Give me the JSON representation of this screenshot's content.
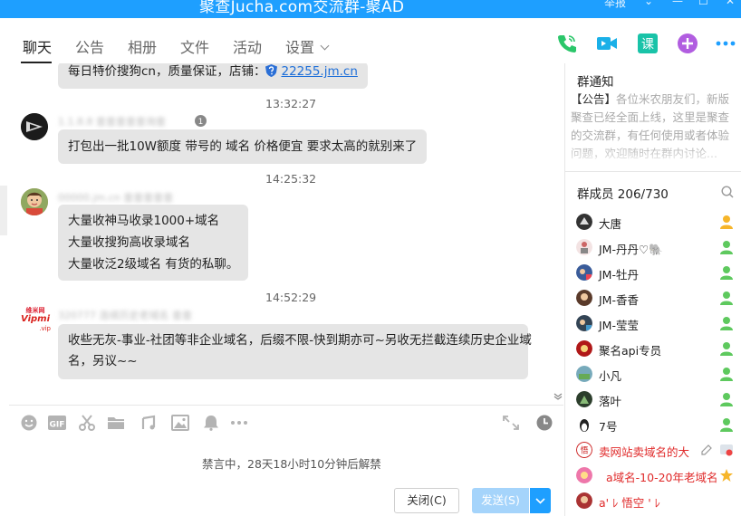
{
  "window": {
    "title": "聚查Jucha.com交流群-聚AD",
    "controls": [
      "举报",
      "⌄",
      "—",
      "☐",
      "✕"
    ]
  },
  "tabs": [
    {
      "label": "聊天"
    },
    {
      "label": "公告"
    },
    {
      "label": "相册"
    },
    {
      "label": "文件"
    },
    {
      "label": "活动"
    },
    {
      "label": "设置"
    }
  ],
  "messages": {
    "m0": {
      "text": "每日特价搜狗cn，质量保证，店铺：",
      "link": "22255.jm.cn"
    },
    "t1": "13:32:27",
    "m1": {
      "nick": "1.1.8.8 查查查查查询查",
      "badge": "1",
      "text": "打包出一批10W额度 带号的 域名 价格便宜 要求太高的就别来了"
    },
    "t2": "14:25:32",
    "m2": {
      "nick": "00000.jm.cn 查查查查查",
      "lines": [
        "大量收神马收录1000+域名",
        "大量收搜狗高收录域名",
        "大量收泛2级域名 有货的私聊。"
      ]
    },
    "t3": "14:52:29",
    "m3": {
      "nick": "320777 连续历史老域名 查查",
      "logo_line1": "维米网",
      "logo_line2": "Vipmi",
      "logo_line3": ".vip",
      "lines": [
        "收些无灰-事业-社团等非企业域名，后缀不限-快到期亦可~另收无拦截连续历史企业域",
        "名，另议~~"
      ]
    }
  },
  "input": {
    "banned_notice": "禁言中，28天18小时10分钟后解禁",
    "close_label": "关闭(C)",
    "send_label": "发送(S)"
  },
  "notice": {
    "title": "群通知",
    "label": "【公告】",
    "body": "各位米农朋友们，新版聚查已经全面上线，这里是聚查的交流群，有任何使用或者体验问题，欢迎随时在群内讨论..."
  },
  "members": {
    "title": "群成员 206/730",
    "list": [
      {
        "name": "大唐",
        "red": false
      },
      {
        "name": "JM-丹丹♡🐘",
        "red": false
      },
      {
        "name": "JM-牡丹",
        "red": false
      },
      {
        "name": "JM-香香",
        "red": false
      },
      {
        "name": "JM-莹莹",
        "red": false
      },
      {
        "name": "聚名api专员",
        "red": false
      },
      {
        "name": "小凡",
        "red": false
      },
      {
        "name": "落叶",
        "red": false
      },
      {
        "name": "7号",
        "red": false
      },
      {
        "name": "卖网站卖域名的大",
        "red": true
      },
      {
        "name": "a域名-10-20年老域名",
        "red": true
      },
      {
        "name": "a' ﾚ 悟空 ' ﾚ",
        "red": true
      }
    ]
  },
  "colors": {
    "accent": "#1e9fff",
    "phone": "#2bc66a",
    "video": "#1ab0e8",
    "class": "#19c3a8",
    "plus": "#b15de0",
    "owner_badge": "#f6b52a",
    "member_badge": "#5ec95e"
  }
}
